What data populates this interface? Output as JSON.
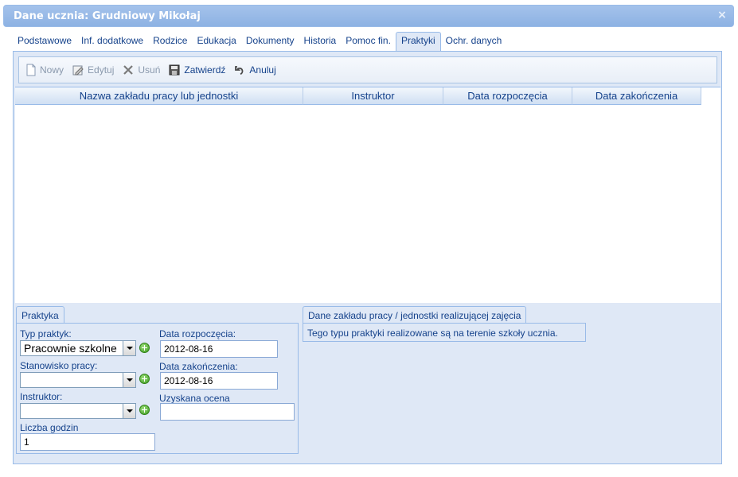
{
  "window": {
    "title": "Dane ucznia: Grudniowy Mikołaj",
    "close_symbol": "×"
  },
  "tabs": [
    {
      "label": "Podstawowe",
      "active": false
    },
    {
      "label": "Inf. dodatkowe",
      "active": false
    },
    {
      "label": "Rodzice",
      "active": false
    },
    {
      "label": "Edukacja",
      "active": false
    },
    {
      "label": "Dokumenty",
      "active": false
    },
    {
      "label": "Historia",
      "active": false
    },
    {
      "label": "Pomoc fin.",
      "active": false
    },
    {
      "label": "Praktyki",
      "active": true
    },
    {
      "label": "Ochr. danych",
      "active": false
    }
  ],
  "toolbar": {
    "new_label": "Nowy",
    "edit_label": "Edytuj",
    "delete_label": "Usuń",
    "confirm_label": "Zatwierdź",
    "cancel_label": "Anuluj"
  },
  "grid": {
    "columns": [
      "Nazwa zakładu pracy lub jednostki",
      "Instruktor",
      "Data rozpoczęcia",
      "Data zakończenia"
    ],
    "rows": []
  },
  "form": {
    "section_tab": "Praktyka",
    "type_label": "Typ praktyk:",
    "type_value": "Pracownie szkolne",
    "position_label": "Stanowisko pracy:",
    "position_value": "",
    "instructor_label": "Instruktor:",
    "instructor_value": "",
    "hours_label": "Liczba godzin",
    "hours_value": "1",
    "start_label": "Data rozpoczęcia:",
    "start_value": "2012-08-16",
    "end_label": "Data zakończenia:",
    "end_value": "2012-08-16",
    "grade_label": "Uzyskana ocena",
    "grade_value": ""
  },
  "company": {
    "section_tab": "Dane zakładu pracy / jednostki realizującej zajęcia",
    "info_text": "Tego typu praktyki realizowane są na terenie szkoły ucznia."
  }
}
